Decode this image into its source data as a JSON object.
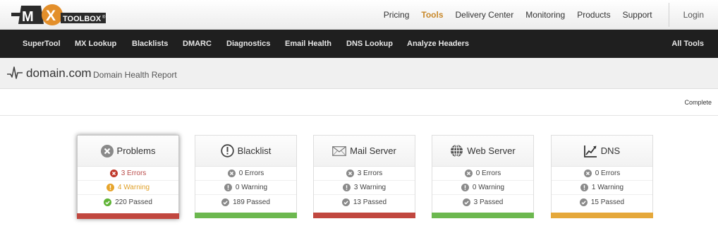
{
  "brand": {
    "logo_letters": "MX",
    "logo_word": "TOOLBOX",
    "reg": "®"
  },
  "topnav": {
    "items": [
      {
        "label": "Pricing",
        "active": false
      },
      {
        "label": "Tools",
        "active": true
      },
      {
        "label": "Delivery Center",
        "active": false
      },
      {
        "label": "Monitoring",
        "active": false
      },
      {
        "label": "Products",
        "active": false
      },
      {
        "label": "Support",
        "active": false
      }
    ],
    "login": "Login"
  },
  "toolbar": {
    "items": [
      "SuperTool",
      "MX Lookup",
      "Blacklists",
      "DMARC",
      "Diagnostics",
      "Email Health",
      "DNS Lookup",
      "Analyze Headers"
    ],
    "all_tools": "All Tools"
  },
  "header": {
    "domain": "domain.com",
    "subtitle": "Domain Health Report"
  },
  "status": {
    "text": "Complete"
  },
  "colors": {
    "error": "#b94a48",
    "warning": "#e6a42b",
    "passed": "#5fb336",
    "neutral": "#8a8a8a",
    "accent": "#c8882a"
  },
  "cards": [
    {
      "title": "Problems",
      "icon": "x-circle-icon",
      "selected": true,
      "errors": "3 Errors",
      "warnings": "4 Warning",
      "passed": "220 Passed",
      "bar_color": "#c1473f",
      "highlight": true
    },
    {
      "title": "Blacklist",
      "icon": "alert-circle-icon",
      "selected": false,
      "errors": "0 Errors",
      "warnings": "0 Warning",
      "passed": "189 Passed",
      "bar_color": "#6cb84f",
      "highlight": false
    },
    {
      "title": "Mail Server",
      "icon": "envelope-icon",
      "selected": false,
      "errors": "3 Errors",
      "warnings": "3 Warning",
      "passed": "13 Passed",
      "bar_color": "#c1473f",
      "highlight": false
    },
    {
      "title": "Web Server",
      "icon": "globe-icon",
      "selected": false,
      "errors": "0 Errors",
      "warnings": "0 Warning",
      "passed": "3 Passed",
      "bar_color": "#6cb84f",
      "highlight": false
    },
    {
      "title": "DNS",
      "icon": "chart-icon",
      "selected": false,
      "errors": "0 Errors",
      "warnings": "1 Warning",
      "passed": "15 Passed",
      "bar_color": "#e5a83a",
      "highlight": false
    }
  ]
}
